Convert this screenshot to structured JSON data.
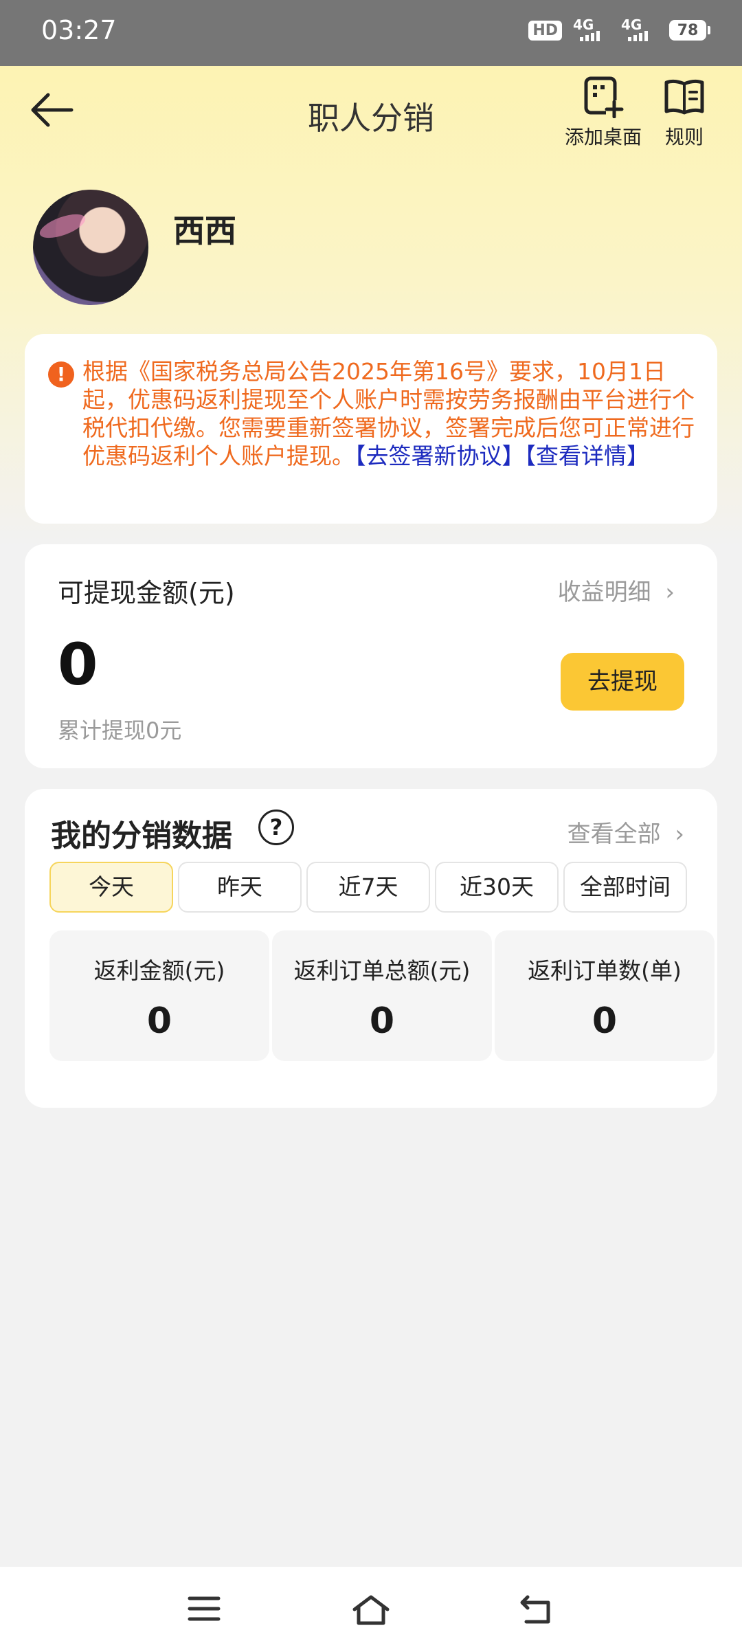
{
  "status_bar": {
    "time": "03:27",
    "hd": "HD",
    "net1": "4G",
    "net2": "4G",
    "battery": "78"
  },
  "header": {
    "title": "职人分销",
    "add_desktop": "添加桌面",
    "rules": "规则"
  },
  "profile": {
    "name": "西西"
  },
  "notice": {
    "text": "根据《国家税务总局公告2025年第16号》要求，10月1日起，优惠码返利提现至个人账户时需按劳务报酬由平台进行个税代扣代缴。您需要重新签署协议，签署完成后您可正常进行优惠码返利个人账户提现。",
    "link_sign": "【去签署新协议】",
    "link_detail": "【查看详情】"
  },
  "withdraw": {
    "label": "可提现金额(元)",
    "detail_link": "收益明细",
    "amount": "0",
    "total": "累计提现0元",
    "button": "去提现"
  },
  "distribution": {
    "title": "我的分销数据",
    "view_all": "查看全部",
    "tabs": [
      "今天",
      "昨天",
      "近7天",
      "近30天",
      "全部时间"
    ],
    "active_tab": "今天",
    "stats": [
      {
        "label": "返利金额(元)",
        "value": "0"
      },
      {
        "label": "返利订单总额(元)",
        "value": "0"
      },
      {
        "label": "返利订单数(单)",
        "value": "0"
      }
    ]
  },
  "colors": {
    "accent": "#fbc734",
    "notice": "#ef6a1f",
    "link": "#1d2bbf"
  }
}
